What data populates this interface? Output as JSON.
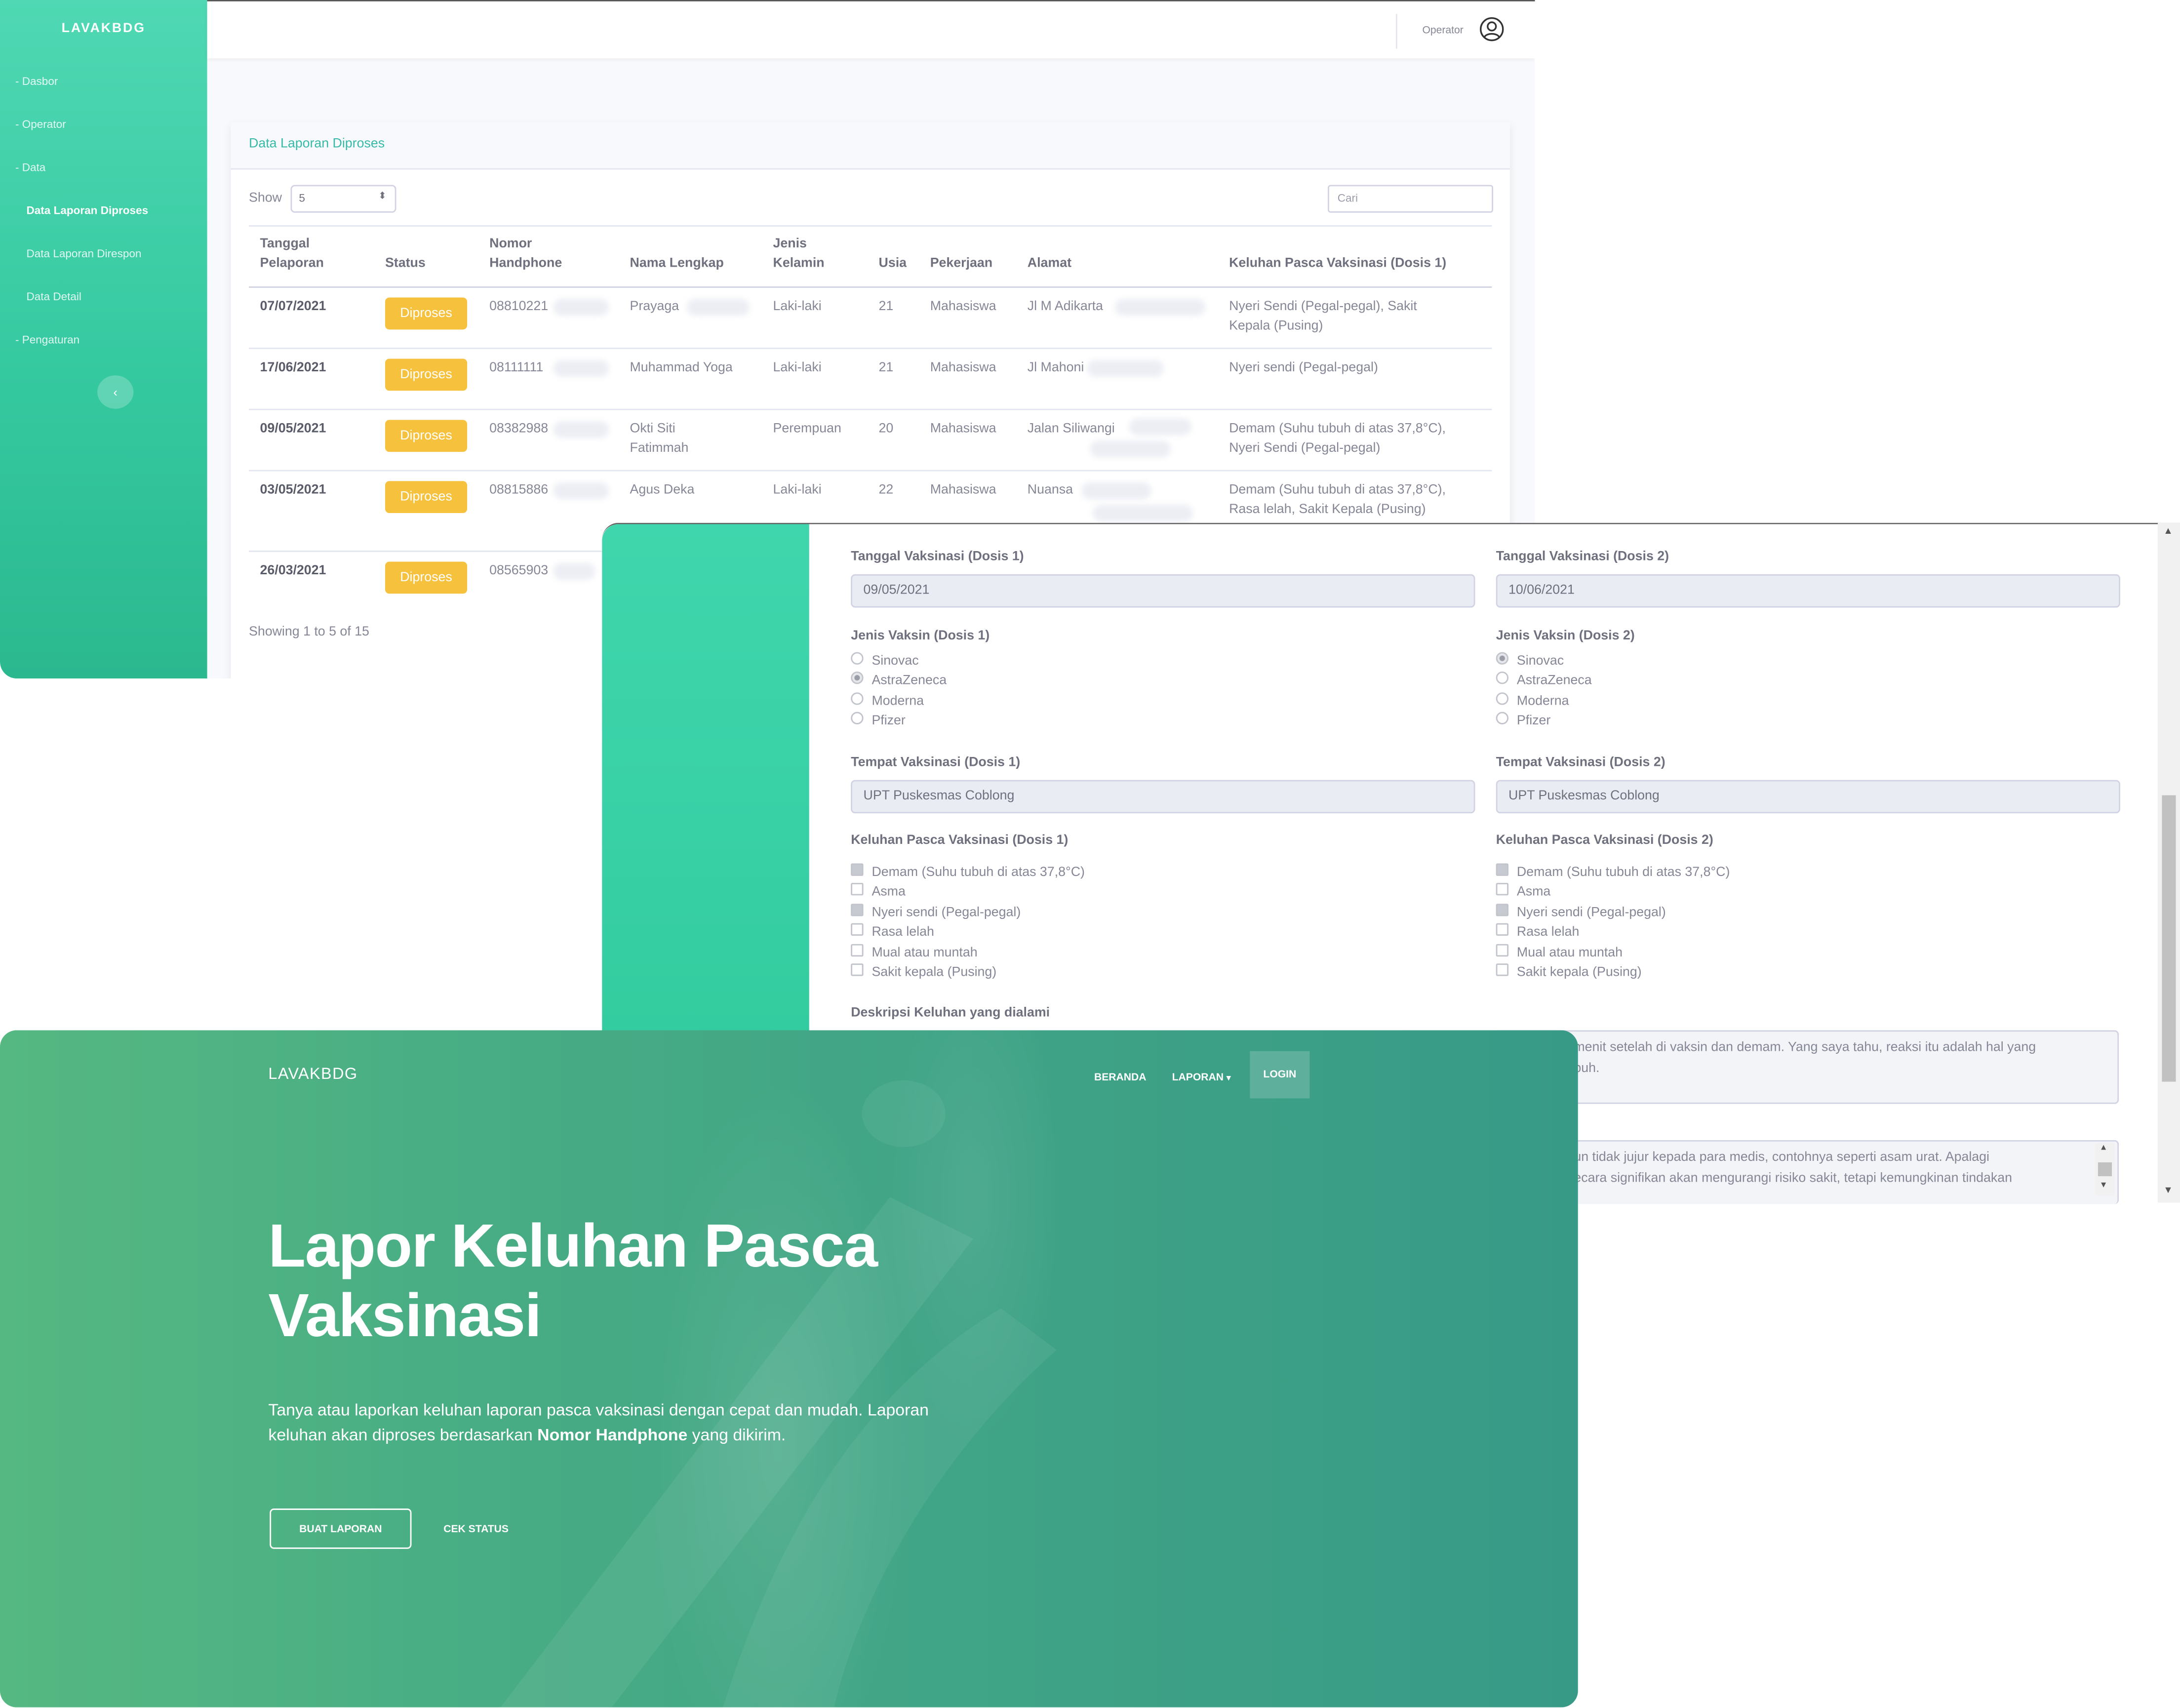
{
  "admin": {
    "brand": "LAVAKBDG",
    "sidebar": [
      {
        "label": "- Dasbor"
      },
      {
        "label": "- Operator"
      },
      {
        "label": "- Data"
      },
      {
        "label": "Data Laporan Diproses"
      },
      {
        "label": "Data Laporan Direspon"
      },
      {
        "label": "Data Detail"
      },
      {
        "label": "- Pengaturan"
      }
    ],
    "sidebar_toggle": "‹",
    "operator_label": "Operator",
    "card_title": "Data Laporan Diproses",
    "show_label": "Show",
    "show_value": "5",
    "search_placeholder": "Cari",
    "headers": {
      "tanggal": [
        "Tanggal",
        "Pelaporan"
      ],
      "status": "Status",
      "nomor": [
        "Nomor",
        "Handphone"
      ],
      "nama": "Nama Lengkap",
      "jenis": [
        "Jenis",
        "Kelamin"
      ],
      "usia": "Usia",
      "pekerjaan": "Pekerjaan",
      "alamat": "Alamat",
      "keluhan": "Keluhan Pasca Vaksinasi (Dosis 1)"
    },
    "rows": [
      {
        "tanggal": "07/07/2021",
        "status": "Diproses",
        "nomor": "08810221",
        "nama": [
          "Prayaga",
          ""
        ],
        "jenis": "Laki-laki",
        "usia": "21",
        "pekerjaan": "Mahasiswa",
        "alamat": "Jl M Adikarta",
        "keluhan": [
          "Nyeri Sendi (Pegal-pegal), Sakit",
          "Kepala (Pusing)"
        ]
      },
      {
        "tanggal": "17/06/2021",
        "status": "Diproses",
        "nomor": "08111111",
        "nama": [
          "Muhammad Yoga",
          ""
        ],
        "jenis": "Laki-laki",
        "usia": "21",
        "pekerjaan": "Mahasiswa",
        "alamat": "Jl Mahoni",
        "keluhan": [
          "Nyeri sendi (Pegal-pegal)",
          ""
        ]
      },
      {
        "tanggal": "09/05/2021",
        "status": "Diproses",
        "nomor": "08382988",
        "nama": [
          "Okti Siti",
          "Fatimmah"
        ],
        "jenis": "Perempuan",
        "usia": "20",
        "pekerjaan": "Mahasiswa",
        "alamat": "Jalan Siliwangi",
        "keluhan": [
          "Demam (Suhu tubuh di atas 37,8°C),",
          "Nyeri Sendi (Pegal-pegal)"
        ]
      },
      {
        "tanggal": "03/05/2021",
        "status": "Diproses",
        "nomor": "08815886",
        "nama": [
          "Agus Deka",
          ""
        ],
        "jenis": "Laki-laki",
        "usia": "22",
        "pekerjaan": "Mahasiswa",
        "alamat": "Nuansa",
        "keluhan": [
          "Demam (Suhu tubuh di atas 37,8°C),",
          "Rasa lelah, Sakit Kepala (Pusing)"
        ]
      },
      {
        "tanggal": "26/03/2021",
        "status": "Diproses",
        "nomor": "08565903"
      }
    ],
    "showing": "Showing 1 to 5 of 15"
  },
  "form": {
    "tanggal_1_label": "Tanggal Vaksinasi (Dosis 1)",
    "tanggal_1": "09/05/2021",
    "tanggal_2_label": "Tanggal Vaksinasi (Dosis 2)",
    "tanggal_2": "10/06/2021",
    "jenis_1_label": "Jenis Vaksin (Dosis 1)",
    "jenis_2_label": "Jenis Vaksin (Dosis 2)",
    "vaccines": [
      "Sinovac",
      "AstraZeneca",
      "Moderna",
      "Pfizer"
    ],
    "jenis_1_selected": "AstraZeneca",
    "jenis_2_selected": "Sinovac",
    "tempat_1_label": "Tempat Vaksinasi (Dosis 1)",
    "tempat_1": "UPT Puskesmas Coblong",
    "tempat_2_label": "Tempat Vaksinasi (Dosis 2)",
    "tempat_2": "UPT Puskesmas Coblong",
    "keluhan_1_label": "Keluhan Pasca Vaksinasi (Dosis 1)",
    "keluhan_2_label": "Keluhan Pasca Vaksinasi (Dosis 2)",
    "symptoms": [
      "Demam (Suhu tubuh di atas 37,8°C)",
      "Asma",
      "Nyeri sendi (Pegal-pegal)",
      "Rasa lelah",
      "Mual atau muntah",
      "Sakit kepala (Pusing)"
    ],
    "keluhan_1_checked": [
      "Demam (Suhu tubuh di atas 37,8°C)",
      "Nyeri sendi (Pegal-pegal)"
    ],
    "keluhan_2_checked": [
      "Demam (Suhu tubuh di atas 37,8°C)",
      "Nyeri sendi (Pegal-pegal)"
    ],
    "deskripsi_label": "Deskripsi Keluhan yang dialami",
    "deskripsi_lines": [
      "menit setelah di vaksin dan demam. Yang saya tahu, reaksi itu adalah hal yang",
      "buh."
    ],
    "respon_lines": [
      "un tidak jujur kepada para medis, contohnya seperti asam urat. Apalagi",
      "ecara signifikan akan mengurangi risiko sakit, tetapi kemungkinan tindakan"
    ]
  },
  "landing": {
    "brand": "LAVAKBDG",
    "nav": {
      "beranda": "BERANDA",
      "laporan": "LAPORAN",
      "login": "LOGIN"
    },
    "hero_title": "Lapor Keluhan Pasca Vaksinasi",
    "hero_sub_pre": "Tanya atau laporkan keluhan laporan pasca vaksinasi dengan cepat dan mudah. Laporan keluhan akan diproses berdasarkan ",
    "hero_sub_bold": "Nomor Handphone",
    "hero_sub_post": " yang dikirim.",
    "btn_buat": "BUAT LAPORAN",
    "btn_cek": "CEK STATUS"
  }
}
